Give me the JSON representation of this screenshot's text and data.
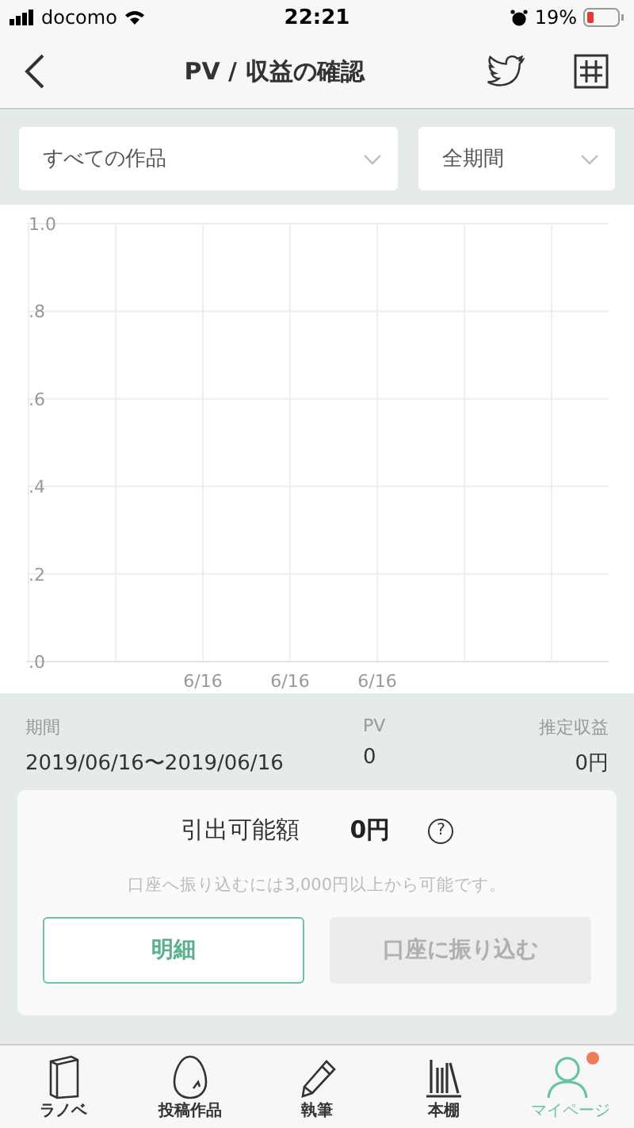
{
  "status_bar": {
    "carrier": "docomo",
    "time": "22:21",
    "battery_percent": "19%"
  },
  "nav": {
    "title": "PV / 収益の確認"
  },
  "filters": [
    {
      "value": "すべての作品"
    },
    {
      "value": "全期間"
    }
  ],
  "chart": {
    "chart_data": {
      "type": "line",
      "grid": true,
      "categories": [
        "6/16",
        "6/16",
        "6/16"
      ],
      "ylim": [
        0,
        1
      ],
      "yticks": [
        {
          "value": 0,
          "label": ".0"
        },
        {
          "value": 0.2,
          "label": ".2"
        },
        {
          "value": 0.4,
          "label": ".4"
        },
        {
          "value": 0.6,
          "label": ".6"
        },
        {
          "value": 0.8,
          "label": ".8"
        },
        {
          "value": 1,
          "label": "1.0"
        }
      ]
    }
  },
  "summary": {
    "columns": [
      {
        "label": "期間",
        "value": "2019/06/16〜2019/06/16"
      },
      {
        "label": "PV",
        "value": "0"
      },
      {
        "label": "推定収益",
        "value": "0円"
      }
    ]
  },
  "withdraw": {
    "label": "引出可能額",
    "amount": "0円",
    "help": "?",
    "note": "口座へ振り込むには3,000円以上から可能です。",
    "buttons": [
      {
        "label": "明細",
        "disabled": false
      },
      {
        "label": "口座に振り込む",
        "disabled": true
      }
    ]
  },
  "tab_bar": [
    {
      "label": "ラノベ",
      "kind": "book",
      "selected": false,
      "badge": false
    },
    {
      "label": "投稿作品",
      "kind": "egg",
      "selected": false,
      "badge": false
    },
    {
      "label": "執筆",
      "kind": "pencil",
      "selected": false,
      "badge": false
    },
    {
      "label": "本棚",
      "kind": "shelf",
      "selected": false,
      "badge": false
    },
    {
      "label": "マイページ",
      "kind": "person",
      "selected": true,
      "badge": true
    }
  ]
}
